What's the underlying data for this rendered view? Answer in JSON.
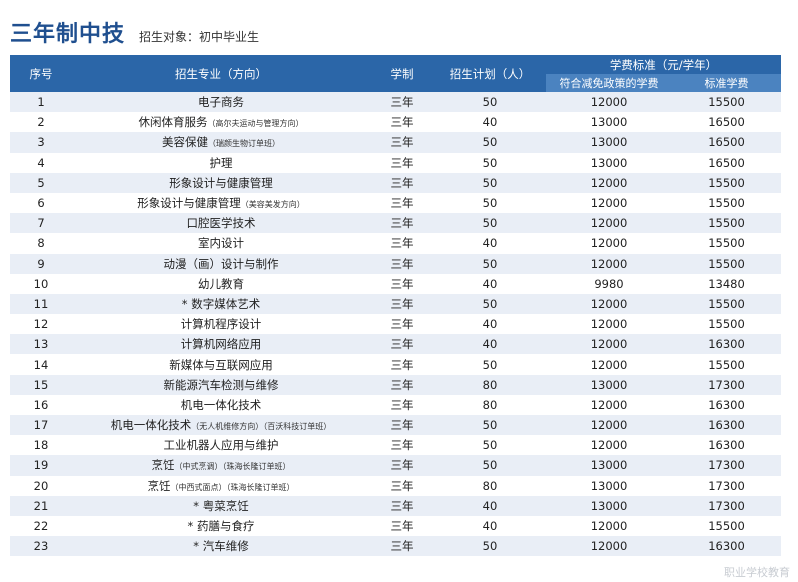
{
  "header": {
    "title": "三年制中技",
    "subtitle": "招生对象：初中毕业生"
  },
  "columns": {
    "index": "序号",
    "major": "招生专业（方向）",
    "duration": "学制",
    "plan": "招生计划（人）",
    "fee_group": "学费标准（元/学年）",
    "fee_reduced": "符合减免政策的学费",
    "fee_standard": "标准学费"
  },
  "rows": [
    {
      "no": "1",
      "major": "电子商务",
      "note": "",
      "duration": "三年",
      "plan": "50",
      "fee_reduced": "12000",
      "fee_standard": "15500"
    },
    {
      "no": "2",
      "major": "休闲体育服务",
      "note": "（高尔夫运动与管理方向）",
      "duration": "三年",
      "plan": "40",
      "fee_reduced": "13000",
      "fee_standard": "16500"
    },
    {
      "no": "3",
      "major": "美容保健",
      "note": "（瑞颜生物订单班）",
      "duration": "三年",
      "plan": "50",
      "fee_reduced": "13000",
      "fee_standard": "16500"
    },
    {
      "no": "4",
      "major": "护理",
      "note": "",
      "duration": "三年",
      "plan": "50",
      "fee_reduced": "13000",
      "fee_standard": "16500"
    },
    {
      "no": "5",
      "major": "形象设计与健康管理",
      "note": "",
      "duration": "三年",
      "plan": "50",
      "fee_reduced": "12000",
      "fee_standard": "15500"
    },
    {
      "no": "6",
      "major": "形象设计与健康管理",
      "note": "（美容美发方向）",
      "duration": "三年",
      "plan": "50",
      "fee_reduced": "12000",
      "fee_standard": "15500"
    },
    {
      "no": "7",
      "major": "口腔医学技术",
      "note": "",
      "duration": "三年",
      "plan": "50",
      "fee_reduced": "12000",
      "fee_standard": "15500"
    },
    {
      "no": "8",
      "major": "室内设计",
      "note": "",
      "duration": "三年",
      "plan": "40",
      "fee_reduced": "12000",
      "fee_standard": "15500"
    },
    {
      "no": "9",
      "major": "动漫（画）设计与制作",
      "note": "",
      "duration": "三年",
      "plan": "50",
      "fee_reduced": "12000",
      "fee_standard": "15500"
    },
    {
      "no": "10",
      "major": "幼儿教育",
      "note": "",
      "duration": "三年",
      "plan": "40",
      "fee_reduced": "9980",
      "fee_standard": "13480"
    },
    {
      "no": "11",
      "major": "* 数字媒体艺术",
      "note": "",
      "duration": "三年",
      "plan": "50",
      "fee_reduced": "12000",
      "fee_standard": "15500"
    },
    {
      "no": "12",
      "major": "计算机程序设计",
      "note": "",
      "duration": "三年",
      "plan": "40",
      "fee_reduced": "12000",
      "fee_standard": "15500"
    },
    {
      "no": "13",
      "major": "计算机网络应用",
      "note": "",
      "duration": "三年",
      "plan": "40",
      "fee_reduced": "12000",
      "fee_standard": "16300"
    },
    {
      "no": "14",
      "major": "新媒体与互联网应用",
      "note": "",
      "duration": "三年",
      "plan": "50",
      "fee_reduced": "12000",
      "fee_standard": "15500"
    },
    {
      "no": "15",
      "major": "新能源汽车检测与维修",
      "note": "",
      "duration": "三年",
      "plan": "80",
      "fee_reduced": "13000",
      "fee_standard": "17300"
    },
    {
      "no": "16",
      "major": "机电一体化技术",
      "note": "",
      "duration": "三年",
      "plan": "80",
      "fee_reduced": "12000",
      "fee_standard": "16300"
    },
    {
      "no": "17",
      "major": "机电一体化技术",
      "note": "（无人机维修方向）（百沃科技订单班）",
      "duration": "三年",
      "plan": "50",
      "fee_reduced": "12000",
      "fee_standard": "16300"
    },
    {
      "no": "18",
      "major": "工业机器人应用与维护",
      "note": "",
      "duration": "三年",
      "plan": "50",
      "fee_reduced": "12000",
      "fee_standard": "16300"
    },
    {
      "no": "19",
      "major": "烹饪",
      "note": "（中式烹调）（珠海长隆订单班）",
      "duration": "三年",
      "plan": "50",
      "fee_reduced": "13000",
      "fee_standard": "17300"
    },
    {
      "no": "20",
      "major": "烹饪",
      "note": "（中西式面点）（珠海长隆订单班）",
      "duration": "三年",
      "plan": "80",
      "fee_reduced": "13000",
      "fee_standard": "17300"
    },
    {
      "no": "21",
      "major": "* 粤菜烹饪",
      "note": "",
      "duration": "三年",
      "plan": "40",
      "fee_reduced": "13000",
      "fee_standard": "17300"
    },
    {
      "no": "22",
      "major": "* 药膳与食疗",
      "note": "",
      "duration": "三年",
      "plan": "40",
      "fee_reduced": "12000",
      "fee_standard": "15500"
    },
    {
      "no": "23",
      "major": "* 汽车维修",
      "note": "",
      "duration": "三年",
      "plan": "50",
      "fee_reduced": "12000",
      "fee_standard": "16300"
    }
  ],
  "watermark": "职业学校教育"
}
